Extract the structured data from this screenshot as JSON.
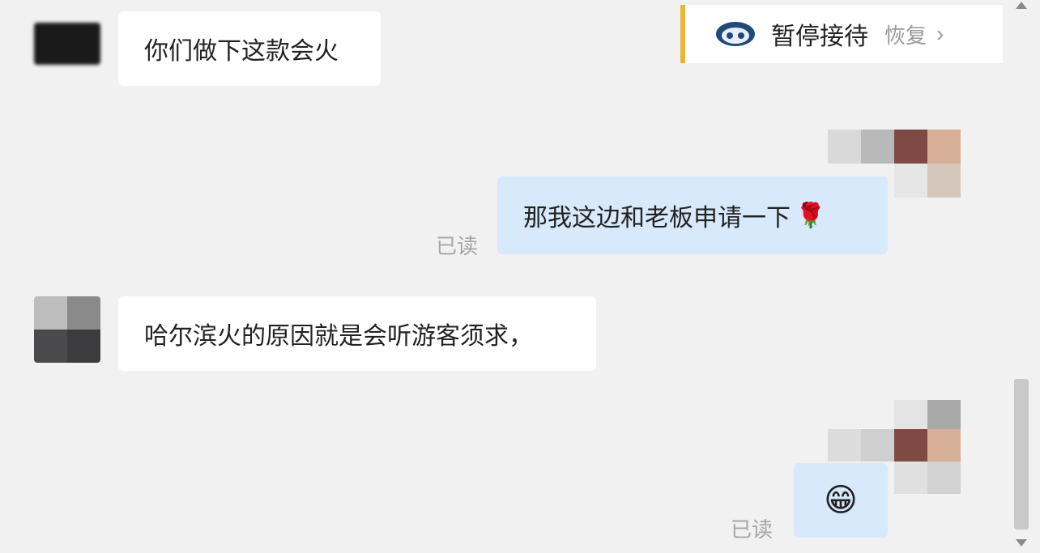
{
  "status_card": {
    "title": "暂停接待",
    "resume_label": "恢复",
    "chevron": "›",
    "icon": "robot-icon",
    "accent": "#e8b43a"
  },
  "messages": [
    {
      "direction": "incoming",
      "text": "你们做下这款会火"
    },
    {
      "direction": "outgoing",
      "text": "那我这边和老板申请一下",
      "emoji": "🌹",
      "read_label": "已读"
    },
    {
      "direction": "incoming",
      "text": "哈尔滨火的原因就是会听游客须求，"
    },
    {
      "direction": "outgoing",
      "text": "",
      "emoji": "😁",
      "read_label": "已读"
    }
  ],
  "colors": {
    "background": "#f1f1f1",
    "incoming_bubble": "#ffffff",
    "outgoing_bubble": "#d7e9fb",
    "read_text": "#a6a6a6"
  }
}
